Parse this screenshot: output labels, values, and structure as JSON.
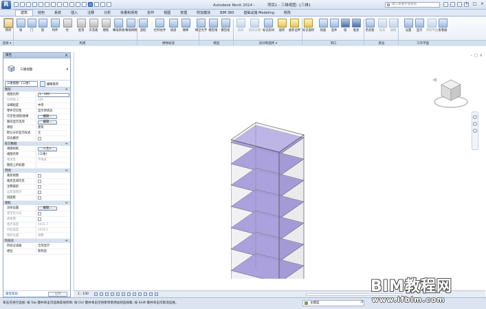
{
  "app": {
    "button_letter": "R",
    "title": "Autodesk Revit 2014 -",
    "doc_title": "项目1 - 三维视图: {三维}",
    "search_placeholder": "键入关键字或短语",
    "window_controls": [
      "–",
      "□",
      "×"
    ]
  },
  "ribbon": {
    "tabs": [
      "建筑",
      "结构",
      "系统",
      "插入",
      "注释",
      "分析",
      "体量和场地",
      "协作",
      "视图",
      "管理",
      "附加模块",
      "BIM 360",
      "基础设施 Modeling",
      "修改"
    ],
    "active_tab": "建筑",
    "buttons": [
      {
        "label": "修改",
        "style": "sel"
      },
      {
        "label": "墙",
        "style": ""
      },
      {
        "label": "门",
        "style": ""
      },
      {
        "label": "窗",
        "style": ""
      },
      {
        "label": "构件",
        "style": ""
      },
      {
        "label": "柱",
        "style": ""
      },
      {
        "label": "屋顶",
        "style": ""
      },
      {
        "label": "天花板",
        "style": ""
      },
      {
        "label": "楼板",
        "style": ""
      },
      {
        "label": "幕墙系统",
        "style": ""
      },
      {
        "label": "幕墙网格",
        "style": ""
      },
      {
        "label": "竖梃",
        "style": ""
      },
      {
        "label": "栏杆扶手",
        "style": ""
      },
      {
        "label": "坡道",
        "style": ""
      },
      {
        "label": "楼梯",
        "style": ""
      },
      {
        "label": "模型文字",
        "style": ""
      },
      {
        "label": "模型线",
        "style": ""
      },
      {
        "label": "模型组",
        "style": ""
      },
      {
        "label": "房间",
        "style": "dim"
      },
      {
        "label": "房间分隔",
        "style": "dim"
      },
      {
        "label": "标记房间",
        "style": ""
      },
      {
        "label": "面积",
        "style": "yl"
      },
      {
        "label": "面积边界",
        "style": "yl"
      },
      {
        "label": "标记面积",
        "style": "yl"
      },
      {
        "label": "按面",
        "style": ""
      },
      {
        "label": "竖井",
        "style": ""
      },
      {
        "label": "墙",
        "style": ""
      },
      {
        "label": "垂直",
        "style": ""
      },
      {
        "label": "老虎窗",
        "style": ""
      },
      {
        "label": "标高",
        "style": "dim"
      },
      {
        "label": "轴网",
        "style": "dim"
      },
      {
        "label": "设置",
        "style": ""
      },
      {
        "label": "显示",
        "style": ""
      },
      {
        "label": "参照平面",
        "style": "dim"
      },
      {
        "label": "查看器",
        "style": ""
      }
    ],
    "panels": [
      "选择 ▾",
      "构建",
      "楼梯坡道",
      "模型",
      "房间和面积 ▾",
      "洞口",
      "基准",
      "工作平面"
    ]
  },
  "properties": {
    "title": "属性",
    "type_name": "三维视图",
    "filter_value": "三维视图: {三维}",
    "edit_type_label": "编辑类型",
    "groups": [
      {
        "name": "图形",
        "rows": [
          {
            "k": "视图比例",
            "v": "1 : 100",
            "kind": "input"
          },
          {
            "k": "比例值 1:",
            "v": "100",
            "kind": "text",
            "dim": true
          },
          {
            "k": "详细程度",
            "v": "中等",
            "kind": "text"
          },
          {
            "k": "零件可见性",
            "v": "显示原状态",
            "kind": "text"
          },
          {
            "k": "可见性/图形替换",
            "v": "编辑...",
            "kind": "button"
          },
          {
            "k": "图形显示选项",
            "v": "编辑...",
            "kind": "button"
          },
          {
            "k": "规程",
            "v": "建筑",
            "kind": "text"
          },
          {
            "k": "默认分析显示样式",
            "v": "无",
            "kind": "text"
          },
          {
            "k": "日光路径",
            "v": "",
            "kind": "check"
          }
        ]
      },
      {
        "name": "标识数据",
        "rows": [
          {
            "k": "视图样板",
            "v": "<无>",
            "kind": "button"
          },
          {
            "k": "视图名称",
            "v": "{三维}",
            "kind": "text"
          },
          {
            "k": "相关性",
            "v": "不相关",
            "kind": "text",
            "dim": true
          },
          {
            "k": "图纸上的标题",
            "v": "",
            "kind": "text"
          }
        ]
      },
      {
        "name": "范围",
        "rows": [
          {
            "k": "裁剪视图",
            "v": "",
            "kind": "check"
          },
          {
            "k": "裁剪区域可见",
            "v": "",
            "kind": "check"
          },
          {
            "k": "注释裁剪",
            "v": "",
            "kind": "check"
          },
          {
            "k": "远剪裁激活",
            "v": "",
            "kind": "check",
            "dim": true
          },
          {
            "k": "剖面框",
            "v": "",
            "kind": "check"
          }
        ]
      },
      {
        "name": "相机",
        "rows": [
          {
            "k": "渲染设置",
            "v": "编辑...",
            "kind": "button"
          },
          {
            "k": "锁定的方向",
            "v": "",
            "kind": "check",
            "dim": true
          },
          {
            "k": "透视图",
            "v": "",
            "kind": "check",
            "dim": true
          },
          {
            "k": "视点高度",
            "v": "4035.7",
            "kind": "text",
            "dim": true
          },
          {
            "k": "目标高度",
            "v": "2459.1",
            "kind": "text",
            "dim": true
          },
          {
            "k": "相机位置",
            "v": "调整",
            "kind": "text",
            "dim": true
          }
        ]
      },
      {
        "name": "阶段化",
        "rows": [
          {
            "k": "阶段过滤器",
            "v": "全部显示",
            "kind": "text"
          },
          {
            "k": "相位",
            "v": "新构造",
            "kind": "text"
          }
        ]
      }
    ],
    "help_link": "属性帮助",
    "apply_label": "应用"
  },
  "view": {
    "scale": "1 : 100",
    "viewcube_label": "",
    "controls": [
      "–",
      "□",
      "×"
    ]
  },
  "building": {
    "floor_fill": "#9b8fe0",
    "floor_count": 7
  },
  "status": {
    "text": "单击可进行选择; 按 Tab 键并单击可选择其他项目; 按 Ctrl 键并单击可将新项目添加到选择集; 按 Shift 键并单击可取消选择。",
    "model": "主模型",
    "zero": ":0"
  },
  "watermark": {
    "title": "BIM教程网",
    "url": "www.ifbim.com"
  }
}
